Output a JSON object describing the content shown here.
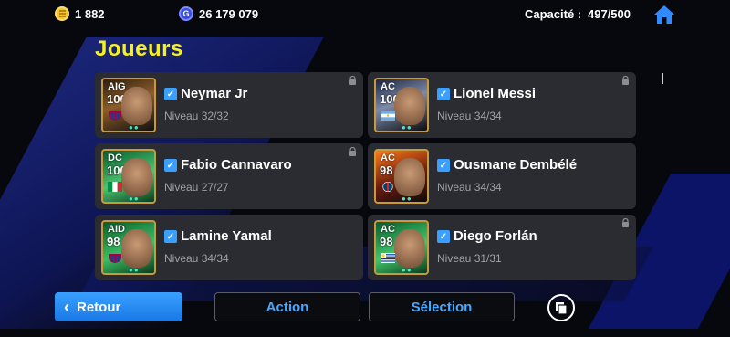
{
  "header": {
    "coins": "1 882",
    "gp": "26 179 079",
    "gp_icon_letter": "G",
    "capacity_label": "Capacité :",
    "capacity_value": "497/500"
  },
  "title": "Joueurs",
  "players": [
    {
      "position": "AIG",
      "rating": "100",
      "name": "Neymar Jr",
      "level": "Niveau 32/32",
      "flag": "fc-barcelona-crest"
    },
    {
      "position": "AC",
      "rating": "100",
      "name": "Lionel Messi",
      "level": "Niveau 34/34",
      "flag": "argentina-flag"
    },
    {
      "position": "DC",
      "rating": "100",
      "name": "Fabio Cannavaro",
      "level": "Niveau 27/27",
      "flag": "italy-flag"
    },
    {
      "position": "AC",
      "rating": "98",
      "name": "Ousmane Dembélé",
      "level": "Niveau 34/34",
      "flag": "psg-crest"
    },
    {
      "position": "AID",
      "rating": "98",
      "name": "Lamine Yamal",
      "level": "Niveau 34/34",
      "flag": "fc-barcelona-crest"
    },
    {
      "position": "AC",
      "rating": "98",
      "name": "Diego Forlán",
      "level": "Niveau 31/31",
      "flag": "uruguay-flag"
    }
  ],
  "footer": {
    "back_label": "Retour",
    "action_label": "Action",
    "selection_label": "Sélection"
  },
  "colors": {
    "title": "#f5f01e",
    "accent_blue": "#39a0ff",
    "card_bg": "#2a2c32",
    "level_text": "#9ea1a8"
  }
}
